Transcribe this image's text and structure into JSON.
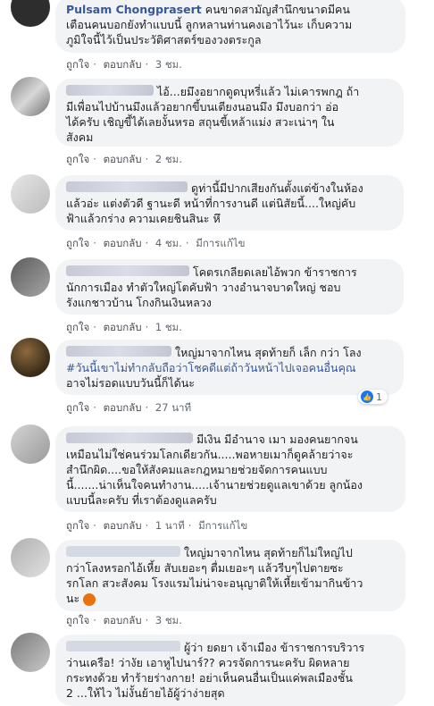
{
  "comments": [
    {
      "name": "Pulsam Chongprasert",
      "lines": [
        "คนขาดสามัญสำนึกขนาดมีคน",
        "เตือนคนบอกยังทำแบบนี้ ลูกหลานท่านคงเอาไว้นะ เก็บความ",
        "ภูมิใจนี้ไว้เป็นประวัติศาสตร์ของวงตระกูล"
      ],
      "like": "ถูกใจ",
      "reply": "ตอบกลับ",
      "time": "3 ชม.",
      "edited": ""
    },
    {
      "name": "",
      "lines": [
        "ไอ้...ยมึงอยากดูดบุหรี่แล้ว ไม่เคารพกฎ ถ้า",
        "มีเพื่อนไปบ้านมึงแล้วอยากขี้บนเตียงนอนมึง มึงบอกว่า อ่อ",
        "ได้ครับ เชิญขี้ได้เลยงั้นหรอ สถุนขี้เหล้าแม่ง สวะเน่าๆ ใน",
        "สังคม"
      ],
      "like": "ถูกใจ",
      "reply": "ตอบกลับ",
      "time": "2 ชม.",
      "edited": ""
    },
    {
      "name": "",
      "lines": [
        "ดูท่านี้มีปากเสียงกันตั้งแต่ข้างในห้อง",
        "แล้วอ่ะ แต่งตัวดี ฐานะดี หน้าที่การงานดี แต่นิสัยนี้....ใหญ่คับ",
        "ฟ้าแล้วกร่าง ความเคยชินสินะ หึ"
      ],
      "like": "ถูกใจ",
      "reply": "ตอบกลับ",
      "time": "4 ชม.",
      "edited": "มีการแก้ไข"
    },
    {
      "name": "",
      "lines": [
        "โคตรเกลียดเลยไอ้พวก ข้าราชการ",
        "นักการเมือง ทำตัวใหญ่โตคับฟ้า วางอำนาจบาดใหญ่ ชอบ",
        "รังแกชาวบ้าน โกงกินเงินหลวง"
      ],
      "like": "ถูกใจ",
      "reply": "ตอบกลับ",
      "time": "1 ชม.",
      "edited": ""
    },
    {
      "name": "",
      "lines": [
        "ใหญ่มาจากไหน สุดท้ายก็ เล็ก กว่า โลง",
        "#วันนี้เขาไม่ทำกลับถือว่าโชคดีแต่ถ้าวันหน้าไปเจอคนอื่นคุณ",
        "อาจไม่รอดแบบวันนี้ก็ได้นะ"
      ],
      "like": "ถูกใจ",
      "reply": "ตอบกลับ",
      "time": "27 นาที",
      "edited": "",
      "reactions": "1"
    },
    {
      "name": "",
      "lines": [
        "มีเงิน มีอำนาจ เมา มองคนยากจน",
        "เหมือนไม่ใช่คนร่วมโลกเดียวกัน.....พอหายเมาก็ดูคล้ายว่าจะ",
        "สำนึกผิด....ขอให้สังคมและกฎหมายช่วยจัดการคนแบบ",
        "นี้.......น่าเห็นใจคนทำงาน.....เจ้านายช่วยดูแลเขาด้วย ลูกน้อง",
        "แบบนี้ละครับ ที่เราต้องดูแลครับ"
      ],
      "like": "ถูกใจ",
      "reply": "ตอบกลับ",
      "time": "1 นาที",
      "edited": "มีการแก้ไข"
    },
    {
      "name": "",
      "lines": [
        "ใหญ่มาจากไหน สุดท้ายก็ไม่ใหญ่ไป",
        "กว่าโลงหรอกไอ้เหี้ย สับเยอะๆ ตื่มเยอะๆ แล้วรีบๆไปตายซะ",
        "รกโลก สวะสังคม โรงแรมไม่น่าจะอนุญาติให้เหี้ยเข้ามากินข้าว",
        "นะ"
      ],
      "like": "ถูกใจ",
      "reply": "ตอบกลับ",
      "time": "3 ชม.",
      "edited": ""
    },
    {
      "name": "",
      "lines": [
        "ผู้ว่า ยดยา เจ้าเมือง ข้าราชการบริวาร",
        "ว่านเครือ! ว่างัย เอาหูไปนาร์?? ควรจัดการนะครับ ผิดหลาย",
        "กระทงด้วย ทำร้ายร่างกาย! อย่าเห็นคนอื่นเป็นแค่พลเมืองชั้น",
        "2 ...ให้ไว ไม่งั้นย้ายไอ้ผู้ว่าง่ายสุด"
      ],
      "like": "",
      "reply": "",
      "time": "",
      "edited": ""
    }
  ]
}
